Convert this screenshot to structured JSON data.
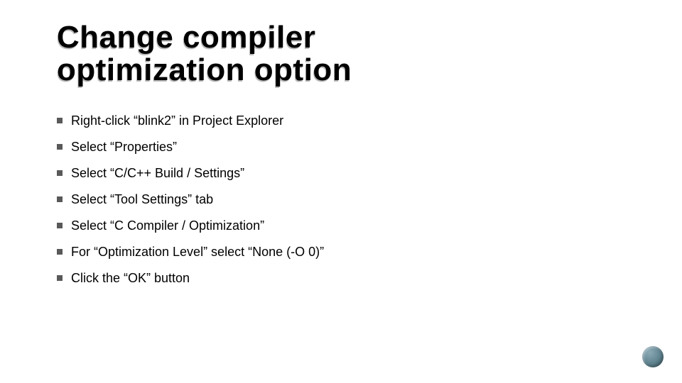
{
  "title_line1": "Change compiler",
  "title_line2": "optimization option",
  "bullets": [
    "Right-click “blink2” in Project Explorer",
    "Select “Properties”",
    "Select “C/C++ Build / Settings”",
    "Select “Tool Settings” tab",
    "Select “C Compiler /  Optimization”",
    "For “Optimization Level” select “None (-O 0)”",
    "Click the “OK” button"
  ]
}
